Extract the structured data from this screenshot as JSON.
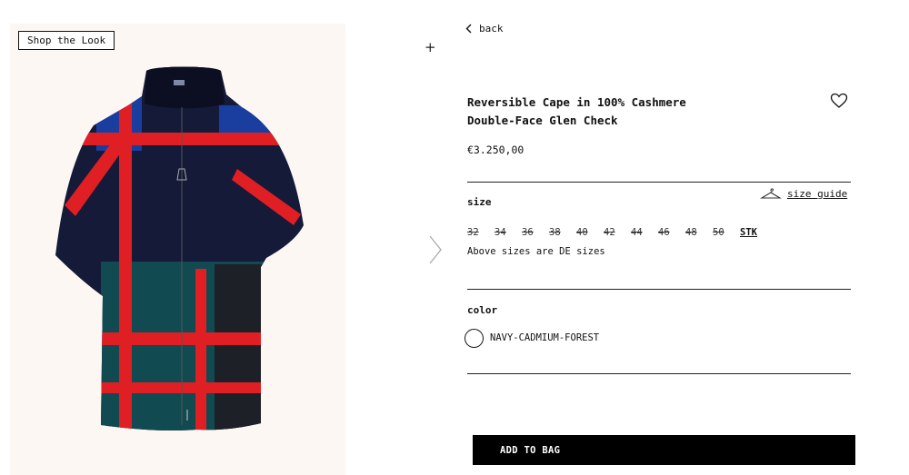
{
  "gallery": {
    "shop_the_look": "Shop the Look",
    "add_icon": "plus-icon",
    "next_icon": "chevron-right-icon"
  },
  "nav": {
    "back_label": "back",
    "back_icon": "chevron-left-icon"
  },
  "product": {
    "title_line1": "Reversible Cape in 100% Cashmere",
    "title_line2": "Double-Face Glen Check",
    "price": "€3.250,00",
    "wishlist_icon": "heart-icon"
  },
  "size": {
    "label": "size",
    "guide_label": "size guide",
    "guide_icon": "hanger-icon",
    "options": [
      {
        "label": "32",
        "available": false
      },
      {
        "label": "34",
        "available": false
      },
      {
        "label": "36",
        "available": false
      },
      {
        "label": "38",
        "available": false
      },
      {
        "label": "40",
        "available": false
      },
      {
        "label": "42",
        "available": false
      },
      {
        "label": "44",
        "available": false
      },
      {
        "label": "46",
        "available": false
      },
      {
        "label": "48",
        "available": false
      },
      {
        "label": "50",
        "available": false
      },
      {
        "label": "STK",
        "available": true
      }
    ],
    "note": "Above sizes are DE sizes"
  },
  "color": {
    "label": "color",
    "selected": "NAVY-CADMIUM-FOREST"
  },
  "cta": {
    "add_to_bag": "ADD TO BAG"
  },
  "theme": {
    "navy": "#141a38",
    "red": "#e01f24",
    "royal": "#1a3ea0",
    "forest": "#114a50",
    "image_bg": "#fdf7f3"
  }
}
